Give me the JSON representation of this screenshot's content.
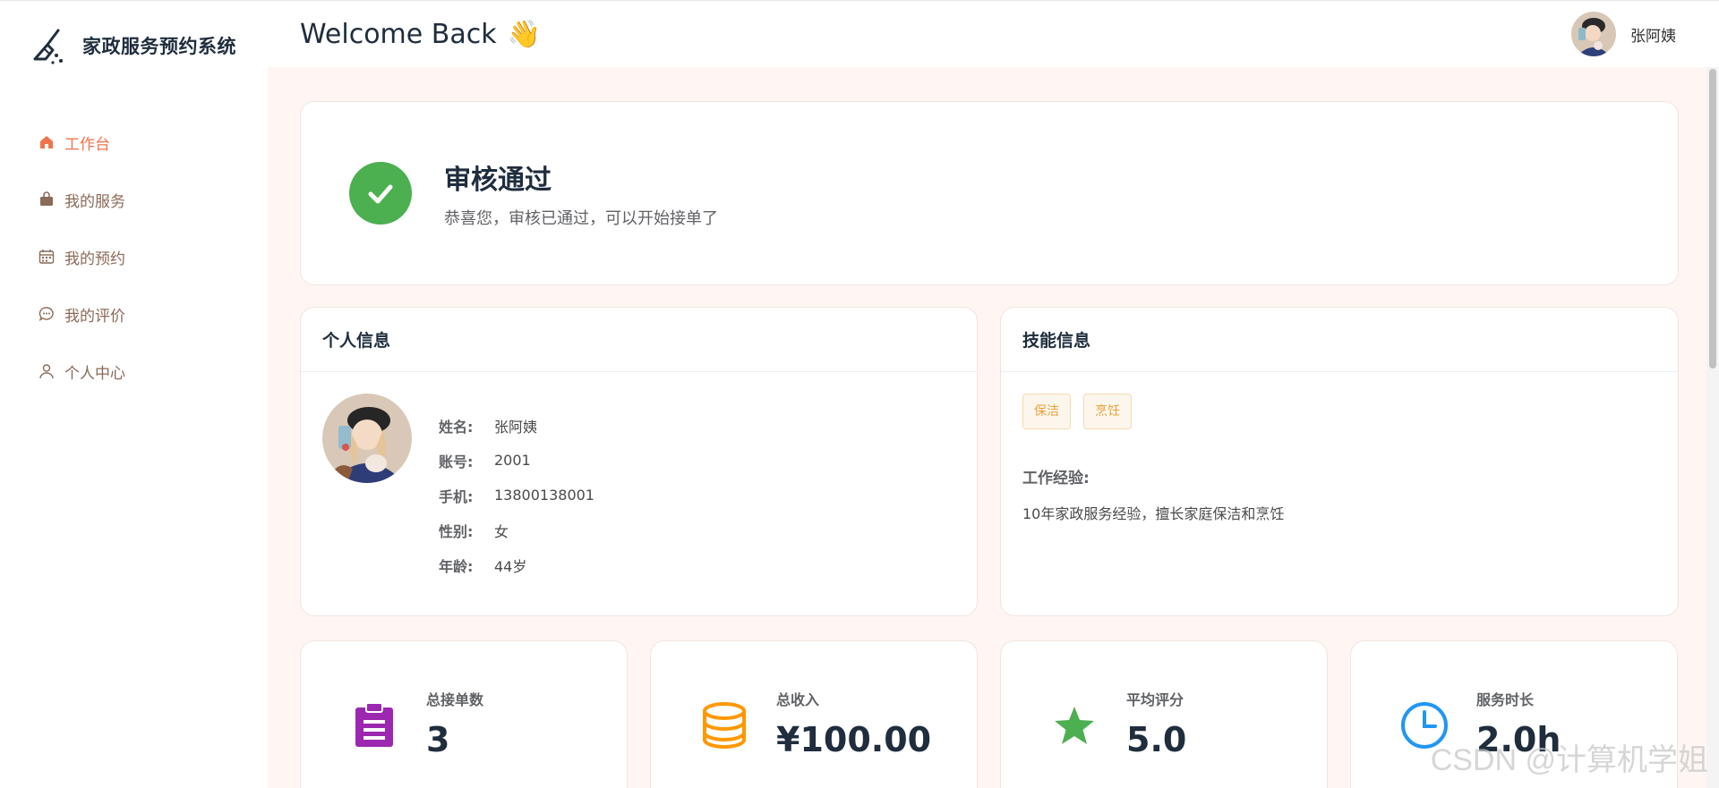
{
  "brand": {
    "title": "家政服务预约系统",
    "icon": "broom-icon"
  },
  "sidebar": {
    "items": [
      {
        "label": "工作台",
        "icon": "home-icon",
        "active": true
      },
      {
        "label": "我的服务",
        "icon": "shopping-bag-icon"
      },
      {
        "label": "我的预约",
        "icon": "calendar-icon"
      },
      {
        "label": "我的评价",
        "icon": "chat-bubble-icon"
      },
      {
        "label": "个人中心",
        "icon": "user-icon"
      }
    ]
  },
  "header": {
    "welcome": "Welcome Back",
    "wave": "👋",
    "user_name": "张阿姨"
  },
  "status": {
    "title": "审核通过",
    "desc": "恭喜您，审核已通过，可以开始接单了"
  },
  "personal": {
    "title": "个人信息",
    "fields": [
      {
        "label": "姓名:",
        "value": "张阿姨"
      },
      {
        "label": "账号:",
        "value": "2001"
      },
      {
        "label": "手机:",
        "value": "13800138001"
      },
      {
        "label": "性别:",
        "value": "女"
      },
      {
        "label": "年龄:",
        "value": "44岁"
      }
    ]
  },
  "skills": {
    "title": "技能信息",
    "tags": [
      "保洁",
      "烹饪"
    ],
    "experience_label": "工作经验:",
    "experience": "10年家政服务经验，擅长家庭保洁和烹饪"
  },
  "stats": [
    {
      "label": "总接单数",
      "value": "3",
      "icon": "clipboard-icon",
      "color": "#9c27b0"
    },
    {
      "label": "总收入",
      "value": "¥100.00",
      "icon": "coins-icon",
      "color": "#ff9800"
    },
    {
      "label": "平均评分",
      "value": "5.0",
      "icon": "star-icon",
      "color": "#4caf50"
    },
    {
      "label": "服务时长",
      "value": "2.0h",
      "icon": "clock-icon",
      "color": "#2196f3"
    }
  ],
  "watermark": "CSDN @计算机学姐",
  "colors": {
    "accent": "#f0744a",
    "success": "#4caf50",
    "background": "#fff6f3"
  }
}
